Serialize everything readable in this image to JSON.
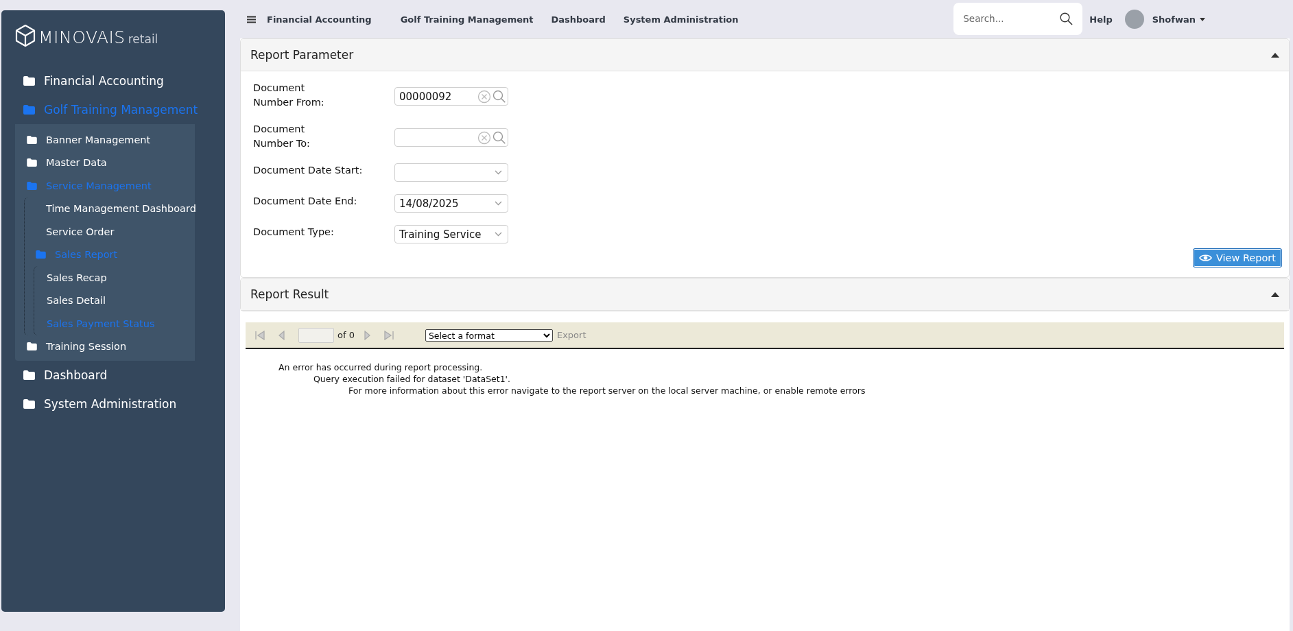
{
  "topbar": {
    "menu": [
      "Financial Accounting",
      "Golf Training Management",
      "Dashboard",
      "System Administration"
    ],
    "search": {
      "placeholder": "Search..."
    },
    "help": "Help",
    "user": "Shofwan"
  },
  "sidebar": {
    "logo": {
      "brand": "MINOVAIS",
      "suffix": "retail"
    },
    "items": [
      {
        "label": "Financial Accounting",
        "kind": "folder",
        "selected": false
      },
      {
        "label": "Golf Training Management",
        "kind": "folder",
        "selected": true,
        "expanded": true,
        "children": [
          {
            "label": "Banner Management",
            "kind": "folder",
            "selected": false
          },
          {
            "label": "Master Data",
            "kind": "folder",
            "selected": false
          },
          {
            "label": "Service Management",
            "kind": "folder",
            "selected": true,
            "expanded": true,
            "children": [
              {
                "label": "Time Management Dashboard",
                "kind": "page",
                "selected": false
              },
              {
                "label": "Service Order",
                "kind": "page",
                "selected": false
              },
              {
                "label": "Sales Report",
                "kind": "folder",
                "selected": true,
                "expanded": true,
                "children": [
                  {
                    "label": "Sales Recap",
                    "kind": "page",
                    "selected": false
                  },
                  {
                    "label": "Sales Detail",
                    "kind": "page",
                    "selected": false
                  },
                  {
                    "label": "Sales Payment Status",
                    "kind": "page",
                    "selected": true
                  }
                ]
              }
            ]
          },
          {
            "label": "Training Session",
            "kind": "folder",
            "selected": false
          }
        ]
      },
      {
        "label": "Dashboard",
        "kind": "folder",
        "selected": false
      },
      {
        "label": "System Administration",
        "kind": "folder",
        "selected": false
      }
    ]
  },
  "report_parameter": {
    "title": "Report Parameter",
    "fields": [
      {
        "label": "Document\nNumber From:",
        "kind": "lookup",
        "value": "00000092"
      },
      {
        "label": "Document\nNumber To:",
        "kind": "lookup"
      },
      {
        "label": "Document Date Start:",
        "kind": "date"
      },
      {
        "label": "Document Date End:",
        "kind": "date",
        "value": "14/08/2025"
      },
      {
        "label": "Document Type:",
        "kind": "select",
        "value": "Training Service"
      }
    ],
    "button": "View Report"
  },
  "report_result": {
    "title": "Report Result",
    "toolbar": {
      "page_of": "of 0",
      "format": "Select a format",
      "export": "Export"
    },
    "messages": [
      "An error has occurred during report processing.",
      "Query execution failed for dataset 'DataSet1'.",
      "For more information about this error navigate to the report server on the local server machine, or enable remote errors"
    ]
  }
}
